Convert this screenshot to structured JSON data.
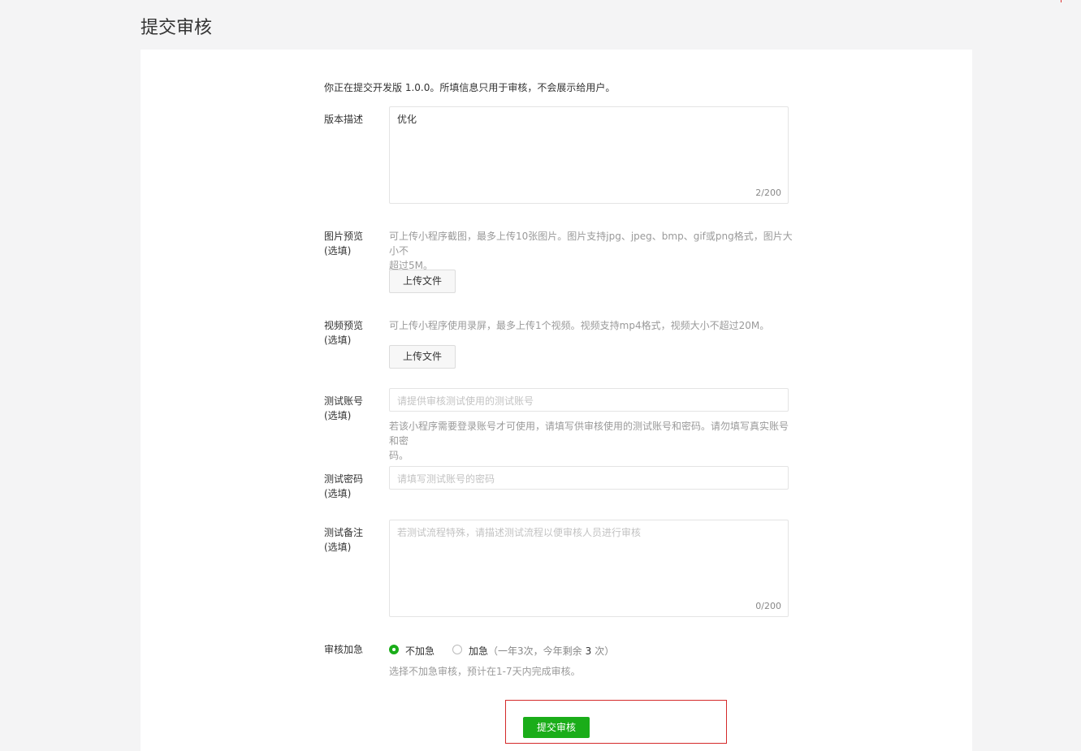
{
  "page": {
    "title": "提交审核"
  },
  "notice": "你正在提交开发版 1.0.0。所填信息只用于审核，不会展示给用户。",
  "version_desc": {
    "label": "版本描述",
    "value": "优化",
    "counter": "2/200"
  },
  "image_preview": {
    "label": "图片预览",
    "optional": "(选填)",
    "hint_line1": "可上传小程序截图，最多上传10张图片。图片支持jpg、jpeg、bmp、gif或png格式，图片大小不",
    "hint_line2": "超过5M。",
    "upload_label": "上传文件"
  },
  "video_preview": {
    "label": "视频预览",
    "optional": "(选填)",
    "hint": "可上传小程序使用录屏，最多上传1个视频。视频支持mp4格式，视频大小不超过20M。",
    "upload_label": "上传文件"
  },
  "test_account": {
    "label": "测试账号",
    "optional": "(选填)",
    "placeholder": "请提供审核测试使用的测试账号",
    "hint_line1": "若该小程序需要登录账号才可使用，请填写供审核使用的测试账号和密码。请勿填写真实账号和密",
    "hint_line2": "码。"
  },
  "test_password": {
    "label": "测试密码",
    "optional": "(选填)",
    "placeholder": "请填写测试账号的密码"
  },
  "test_notes": {
    "label": "测试备注",
    "optional": "(选填)",
    "placeholder": "若测试流程特殊，请描述测试流程以便审核人员进行审核",
    "counter": "0/200"
  },
  "urgent": {
    "label": "审核加急",
    "option_normal": "不加急",
    "option_urgent": "加急",
    "urgent_note_prefix": "（一年3次，今年剩余",
    "urgent_remaining": "3",
    "urgent_note_suffix": "次）",
    "hint": "选择不加急审核，预计在1-7天内完成审核。"
  },
  "submit": {
    "label": "提交审核"
  },
  "colors": {
    "accent": "#1aad19",
    "highlight_border": "#d42a2a"
  }
}
